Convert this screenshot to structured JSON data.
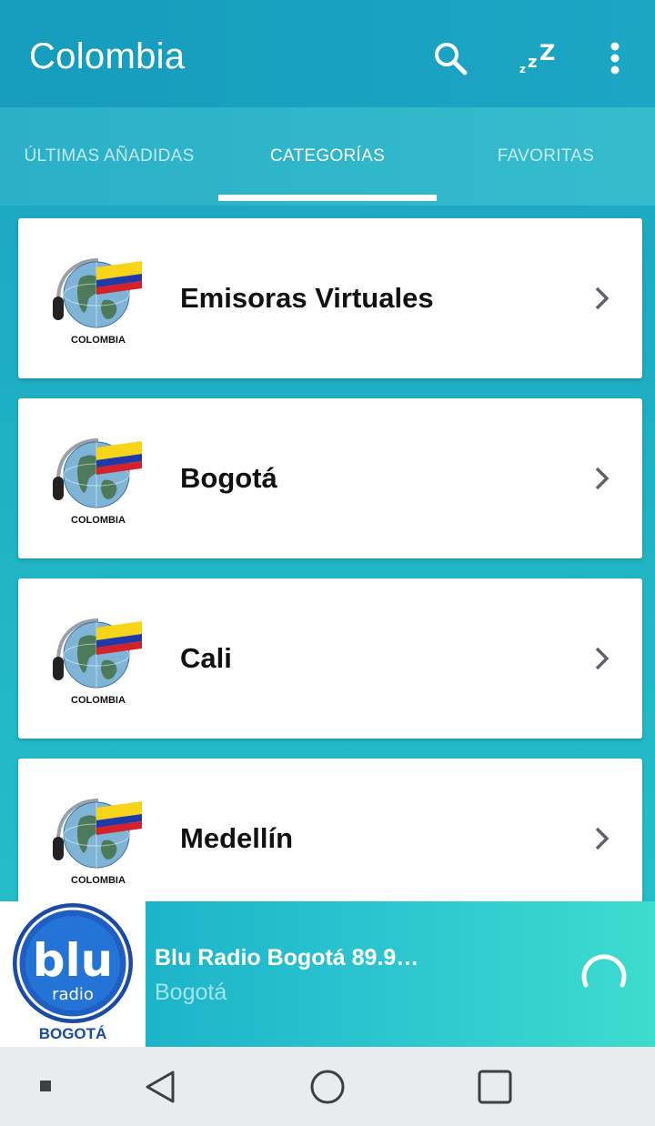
{
  "appbar": {
    "title": "Colombia",
    "icons": [
      "search-icon",
      "sleep-timer-icon",
      "more-vert-icon"
    ]
  },
  "tabs": [
    {
      "label": "ÚLTIMAS AÑADIDAS",
      "active": false
    },
    {
      "label": "CATEGORÍAS",
      "active": true
    },
    {
      "label": "FAVORITAS",
      "active": false
    }
  ],
  "categories": [
    {
      "title": "Emisoras Virtuales",
      "logo_text": "COLOMBIA"
    },
    {
      "title": "Bogotá",
      "logo_text": "COLOMBIA"
    },
    {
      "title": "Cali",
      "logo_text": "COLOMBIA"
    },
    {
      "title": "Medellín",
      "logo_text": "COLOMBIA"
    }
  ],
  "player": {
    "station": "Blu Radio Bogotá 89.9…",
    "city": "Bogotá",
    "logo_word": "blu",
    "logo_sub": "radio",
    "logo_city": "BOGOTÁ",
    "status": "loading"
  },
  "colors": {
    "appbar": "#169cbc",
    "accent": "#ffffff",
    "blu_brand": "#1b4aa3"
  }
}
